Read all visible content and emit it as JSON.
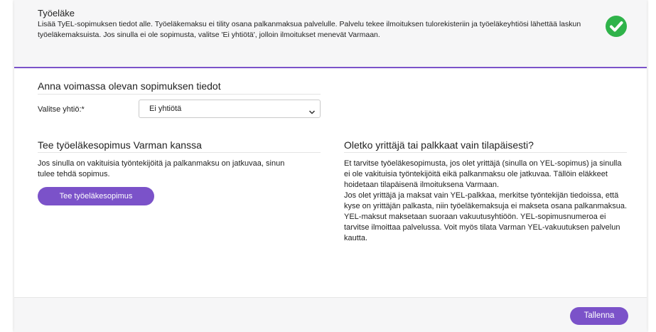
{
  "header": {
    "title": "Työeläke",
    "description": "Lisää TyEL-sopimuksen tiedot alle. Työeläkemaksu ei tility osana palkanmaksua palvelulle. Palvelu tekee ilmoituksen tulorekisteriin ja työeläkeyhtiösi lähettää laskun työeläkemaksuista. Jos sinulla ei ole sopimusta, valitse 'Ei yhtiötä', jolloin ilmoitukset menevät Varmaan.",
    "status_icon": "check-circle-icon",
    "status_color": "#2fb34a"
  },
  "contract": {
    "title": "Anna voimassa olevan sopimuksen tiedot",
    "company_label": "Valitse yhtiö:*",
    "company_selected": "Ei yhtiötä"
  },
  "new_contract": {
    "title": "Tee työeläkesopimus Varman kanssa",
    "text": "Jos sinulla on vakituisia työntekijöitä ja palkanmaksu on jatkuvaa, sinun tulee tehdä sopimus.",
    "button_label": "Tee työeläkesopimus"
  },
  "entrepreneur": {
    "title": "Oletko yrittäjä tai palkkaat vain tilapäisesti?",
    "text": "Et tarvitse työeläkesopimusta, jos olet yrittäjä (sinulla on YEL-sopimus) ja sinulla ei ole vakituisia työntekijöitä eikä palkanmaksu ole jatkuvaa. Tällöin eläkkeet hoidetaan tilapäisenä ilmoituksena Varmaan.\nJos olet yrittäjä ja maksat vain YEL-palkkaa, merkitse työntekijän tiedoissa, että kyse on yrittäjän palkasta, niin työeläkemaksuja ei makseta osana palkanmaksua. YEL-maksut maksetaan suoraan vakuutusyhtiöön. YEL-sopimusnumeroa ei tarvitse ilmoittaa palvelussa. Voit myös tilata Varman YEL-vakuutuksen palvelun kautta."
  },
  "footer": {
    "save_label": "Tallenna"
  },
  "colors": {
    "accent": "#7b52c9"
  }
}
